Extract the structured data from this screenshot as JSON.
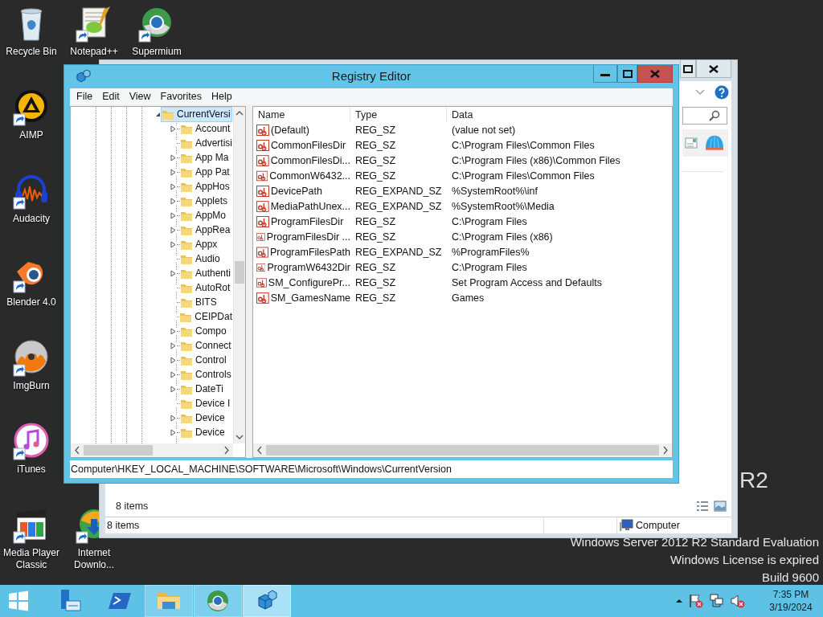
{
  "desktop_icons": [
    {
      "label": "Recycle Bin"
    },
    {
      "label": "Notepad++"
    },
    {
      "label": "Supermium"
    },
    {
      "label": "AIMP"
    },
    {
      "label": "Audacity"
    },
    {
      "label": "Blender 4.0"
    },
    {
      "label": "ImgBurn"
    },
    {
      "label": "iTunes"
    },
    {
      "label": "Media Player Classic"
    },
    {
      "label": "Internet Downlo..."
    }
  ],
  "desktop_branding": {
    "logo_text": "R2",
    "lines": [
      "Windows Server 2012 R2 Standard Evaluation",
      "Windows License is expired",
      "Build 9600"
    ]
  },
  "explorer_window": {
    "items_count": "8 items",
    "status_count": "8 items",
    "status_location": "Computer"
  },
  "registry_editor": {
    "title": "Registry Editor",
    "menu": [
      "File",
      "Edit",
      "View",
      "Favorites",
      "Help"
    ],
    "tree": {
      "label": "CurrentVersi",
      "expanded": true,
      "selected": true,
      "children": [
        {
          "label": "Account",
          "expandable": true,
          "selected": false
        },
        {
          "label": "Advertisi",
          "expandable": false,
          "selected": false
        },
        {
          "label": "App Ma",
          "expandable": true,
          "selected": false
        },
        {
          "label": "App Pat",
          "expandable": true,
          "selected": false
        },
        {
          "label": "AppHos",
          "expandable": true,
          "selected": false
        },
        {
          "label": "Applets",
          "expandable": true,
          "selected": false
        },
        {
          "label": "AppMo",
          "expandable": true,
          "selected": false
        },
        {
          "label": "AppRea",
          "expandable": true,
          "selected": false
        },
        {
          "label": "Appx",
          "expandable": true,
          "selected": false
        },
        {
          "label": "Audio",
          "expandable": false,
          "selected": false
        },
        {
          "label": "Authenti",
          "expandable": true,
          "selected": false
        },
        {
          "label": "AutoRot",
          "expandable": false,
          "selected": false
        },
        {
          "label": "BITS",
          "expandable": false,
          "selected": false
        },
        {
          "label": "CEIPDat",
          "expandable": false,
          "selected": false
        },
        {
          "label": "Compo",
          "expandable": true,
          "selected": false
        },
        {
          "label": "Connect",
          "expandable": true,
          "selected": false
        },
        {
          "label": "Control",
          "expandable": true,
          "selected": false
        },
        {
          "label": "Controls",
          "expandable": true,
          "selected": false
        },
        {
          "label": "DateTi",
          "expandable": true,
          "selected": false
        },
        {
          "label": "Device I",
          "expandable": false,
          "selected": false
        },
        {
          "label": "Device",
          "expandable": true,
          "selected": false
        },
        {
          "label": "Device",
          "expandable": true,
          "selected": false
        }
      ]
    },
    "columns": [
      "Name",
      "Type",
      "Data"
    ],
    "values": [
      {
        "name": "(Default)",
        "type": "REG_SZ",
        "data": "(value not set)",
        "selected": false
      },
      {
        "name": "CommonFilesDir",
        "type": "REG_SZ",
        "data": "C:\\Program Files\\Common Files",
        "selected": false
      },
      {
        "name": "CommonFilesDi...",
        "type": "REG_SZ",
        "data": "C:\\Program Files (x86)\\Common Files",
        "selected": false
      },
      {
        "name": "CommonW6432...",
        "type": "REG_SZ",
        "data": "C:\\Program Files\\Common Files",
        "selected": false
      },
      {
        "name": "DevicePath",
        "type": "REG_EXPAND_SZ",
        "data": "%SystemRoot%\\inf",
        "selected": false
      },
      {
        "name": "MediaPathUnex...",
        "type": "REG_EXPAND_SZ",
        "data": "%SystemRoot%\\Media",
        "selected": false
      },
      {
        "name": "ProgramFilesDir",
        "type": "REG_SZ",
        "data": "C:\\Program Files",
        "selected": false
      },
      {
        "name": "ProgramFilesDir ...",
        "type": "REG_SZ",
        "data": "C:\\Program Files (x86)",
        "selected": false
      },
      {
        "name": "ProgramFilesPath",
        "type": "REG_EXPAND_SZ",
        "data": "%ProgramFiles%",
        "selected": false
      },
      {
        "name": "ProgramW6432Dir",
        "type": "REG_SZ",
        "data": "C:\\Program Files",
        "selected": false
      },
      {
        "name": "SM_ConfigurePr...",
        "type": "REG_SZ",
        "data": "Set Program Access and Defaults",
        "selected": false
      },
      {
        "name": "SM_GamesName",
        "type": "REG_SZ",
        "data": "Games",
        "selected": false
      }
    ],
    "path": "Computer\\HKEY_LOCAL_MACHINE\\SOFTWARE\\Microsoft\\Windows\\CurrentVersion"
  },
  "taskbar": {
    "apps": [
      {
        "running": false,
        "selected": false
      },
      {
        "running": false,
        "selected": false
      },
      {
        "running": true,
        "selected": false
      },
      {
        "running": true,
        "selected": false
      },
      {
        "running": true,
        "selected": true
      }
    ],
    "clock": {
      "time": "7:35 PM",
      "date": "3/19/2024"
    }
  }
}
